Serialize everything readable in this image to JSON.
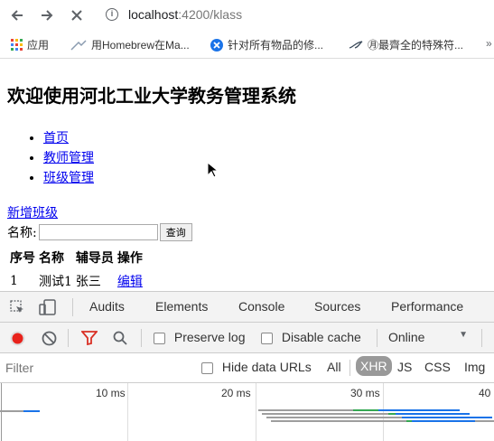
{
  "browser": {
    "url_host": "localhost",
    "url_path": ":4200/klass",
    "bookmarks": [
      {
        "label": "应用",
        "icon": "apps-grid-icon"
      },
      {
        "label": "用Homebrew在Ma...",
        "icon": "homebrew-icon"
      },
      {
        "label": "针对所有物品的修...",
        "icon": "x-circle-icon"
      },
      {
        "label": "㊊最齊全的特殊符...",
        "icon": "bird-icon"
      },
      {
        "label": "",
        "icon": "chevron-icon"
      }
    ]
  },
  "page": {
    "title": "欢迎使用河北工业大学教务管理系统",
    "nav": [
      "首页",
      "教师管理",
      "班级管理"
    ],
    "add_link": "新增班级",
    "search_label": "名称:",
    "search_placeholder": "",
    "search_button": "查询",
    "table": {
      "headers": [
        "序号",
        "名称",
        "辅导员",
        "操作"
      ],
      "rows": [
        {
          "id": "1",
          "name": "测试1",
          "counselor": "张三",
          "action": "编辑"
        }
      ]
    }
  },
  "devtools": {
    "tabs": [
      "Audits",
      "Elements",
      "Console",
      "Sources",
      "Performance"
    ],
    "preserve_log": "Preserve log",
    "disable_cache": "Disable cache",
    "throttle": "Online",
    "filter_placeholder": "Filter",
    "hide_data_urls": "Hide data URLs",
    "type_filters": [
      "All",
      "XHR",
      "JS",
      "CSS",
      "Img"
    ],
    "active_type": "XHR",
    "timeline_ticks": [
      "10 ms",
      "20 ms",
      "30 ms",
      "40"
    ]
  },
  "colors": {
    "record": "#e8221b",
    "filter_icon": "#d93025",
    "link": "#0000ee",
    "xhr_chip": "#999999",
    "bar_blue": "#1a73e8",
    "bar_green": "#34a853",
    "bar_gray": "#9e9e9e"
  }
}
